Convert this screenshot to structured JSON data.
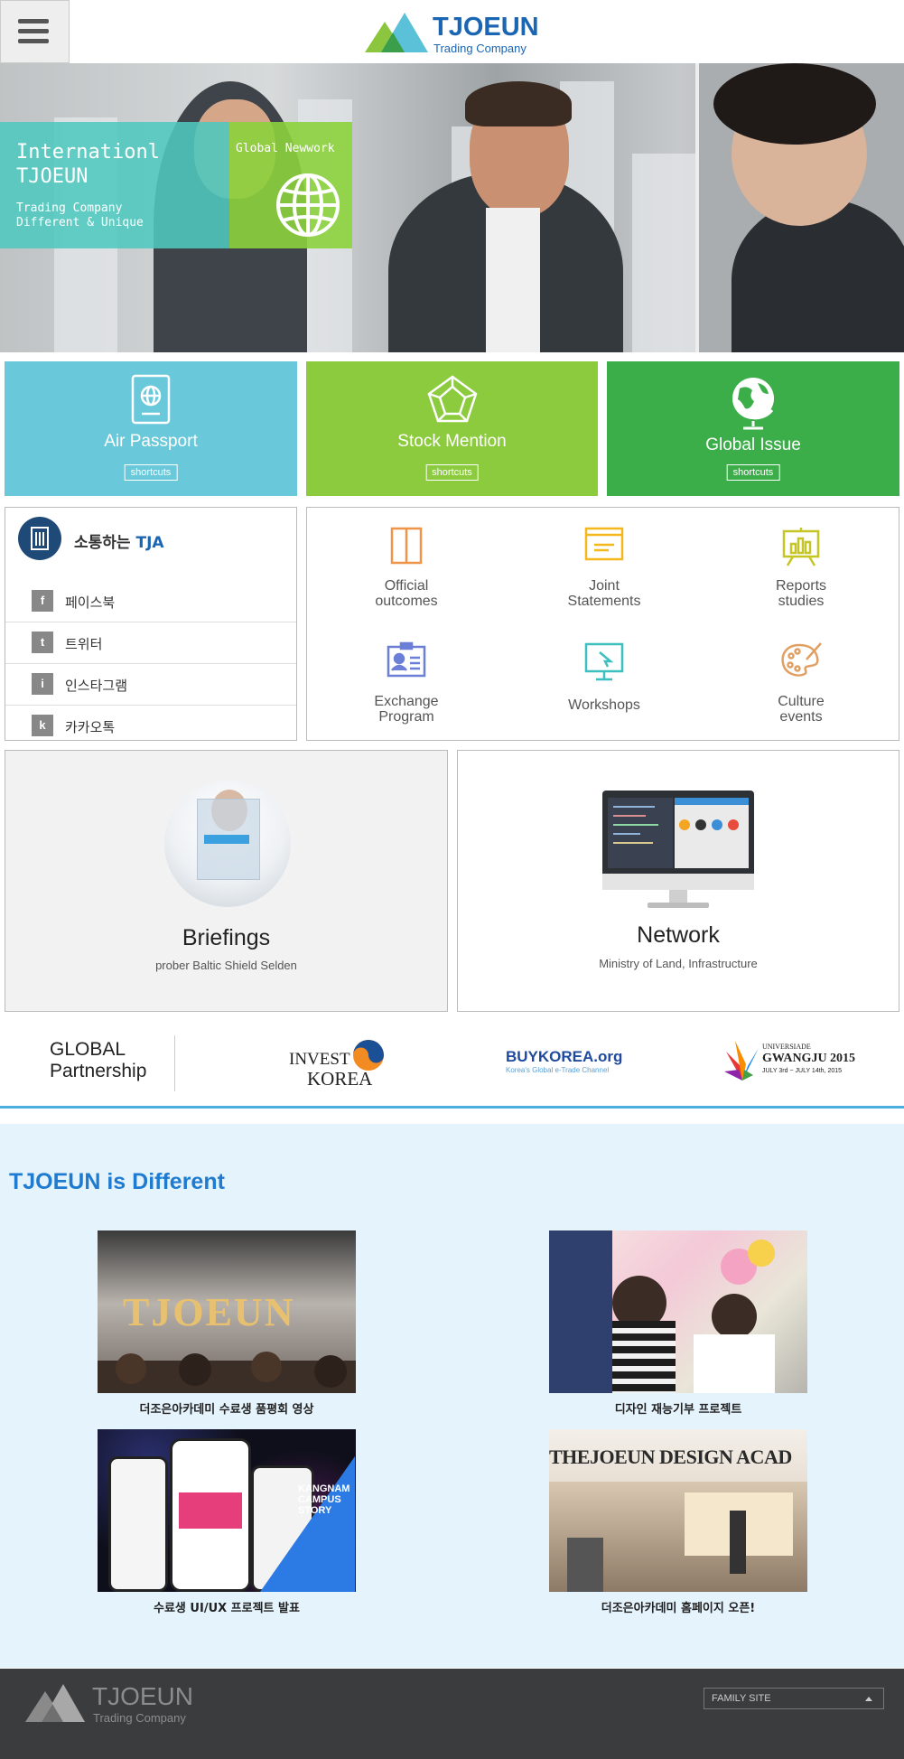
{
  "header": {
    "logo_title": "TJOEUN",
    "logo_sub": "Trading Company"
  },
  "hero": {
    "line1": "Internationl",
    "line2": "TJOEUN",
    "line3": "Trading Company",
    "line4": "Different & Unique",
    "badge": "Global Newwork"
  },
  "tiles": [
    {
      "title": "Air Passport",
      "button": "shortcuts",
      "color": "#69c8da"
    },
    {
      "title": "Stock Mention",
      "button": "shortcuts",
      "color": "#8ccb3e"
    },
    {
      "title": "Global Issue",
      "button": "shortcuts",
      "color": "#3bae4a"
    }
  ],
  "social": {
    "title_a": "소통하는 ",
    "title_b": "TJA",
    "items": [
      {
        "icon": "f",
        "label": "페이스북"
      },
      {
        "icon": "t",
        "label": "트위터"
      },
      {
        "icon": "i",
        "label": "인스타그램"
      },
      {
        "icon": "k",
        "label": "카카오톡"
      }
    ]
  },
  "services": [
    {
      "line1": "Official",
      "line2": "outcomes"
    },
    {
      "line1": "Joint",
      "line2": "Statements"
    },
    {
      "line1": "Reports",
      "line2": "studies"
    },
    {
      "line1": "Exchange",
      "line2": "Program"
    },
    {
      "line1": "Workshops",
      "line2": ""
    },
    {
      "line1": "Culture",
      "line2": "events"
    }
  ],
  "cards": [
    {
      "title": "Briefings",
      "sub": "prober Baltic Shield Selden"
    },
    {
      "title": "Network",
      "sub": "Ministry of Land, Infrastructure"
    }
  ],
  "partners": {
    "label1": "GLOBAL",
    "label2": "Partnership",
    "invest1": "INVEST",
    "invest2": "KOREA",
    "buy": "BUYKOREA.org",
    "buy_sub": "Korea's Global e-Trade Channel",
    "uni1": "UNIVERSIADE",
    "uni2": "GWANGJU 2015",
    "uni3": "JULY 3rd ~ JULY 14th, 2015"
  },
  "different": {
    "title": "TJOEUN is Different",
    "items": [
      {
        "caption": "더조은아카데미 수료생 품평회 영상",
        "img_text": "TJOEUN"
      },
      {
        "caption": "디자인 재능기부 프로젝트",
        "img_text": ""
      },
      {
        "caption": "수료생 UI/UX 프로젝트 발표",
        "img_text": "KANGNAM CAMPUS STORY"
      },
      {
        "caption": "더조은아카데미 홈페이지 오픈!",
        "img_text": "THEJOEUN DESIGN ACAD"
      }
    ]
  },
  "footer": {
    "logo_title": "TJOEUN",
    "logo_sub": "Trading Company",
    "family_site": "FAMILY SITE"
  }
}
